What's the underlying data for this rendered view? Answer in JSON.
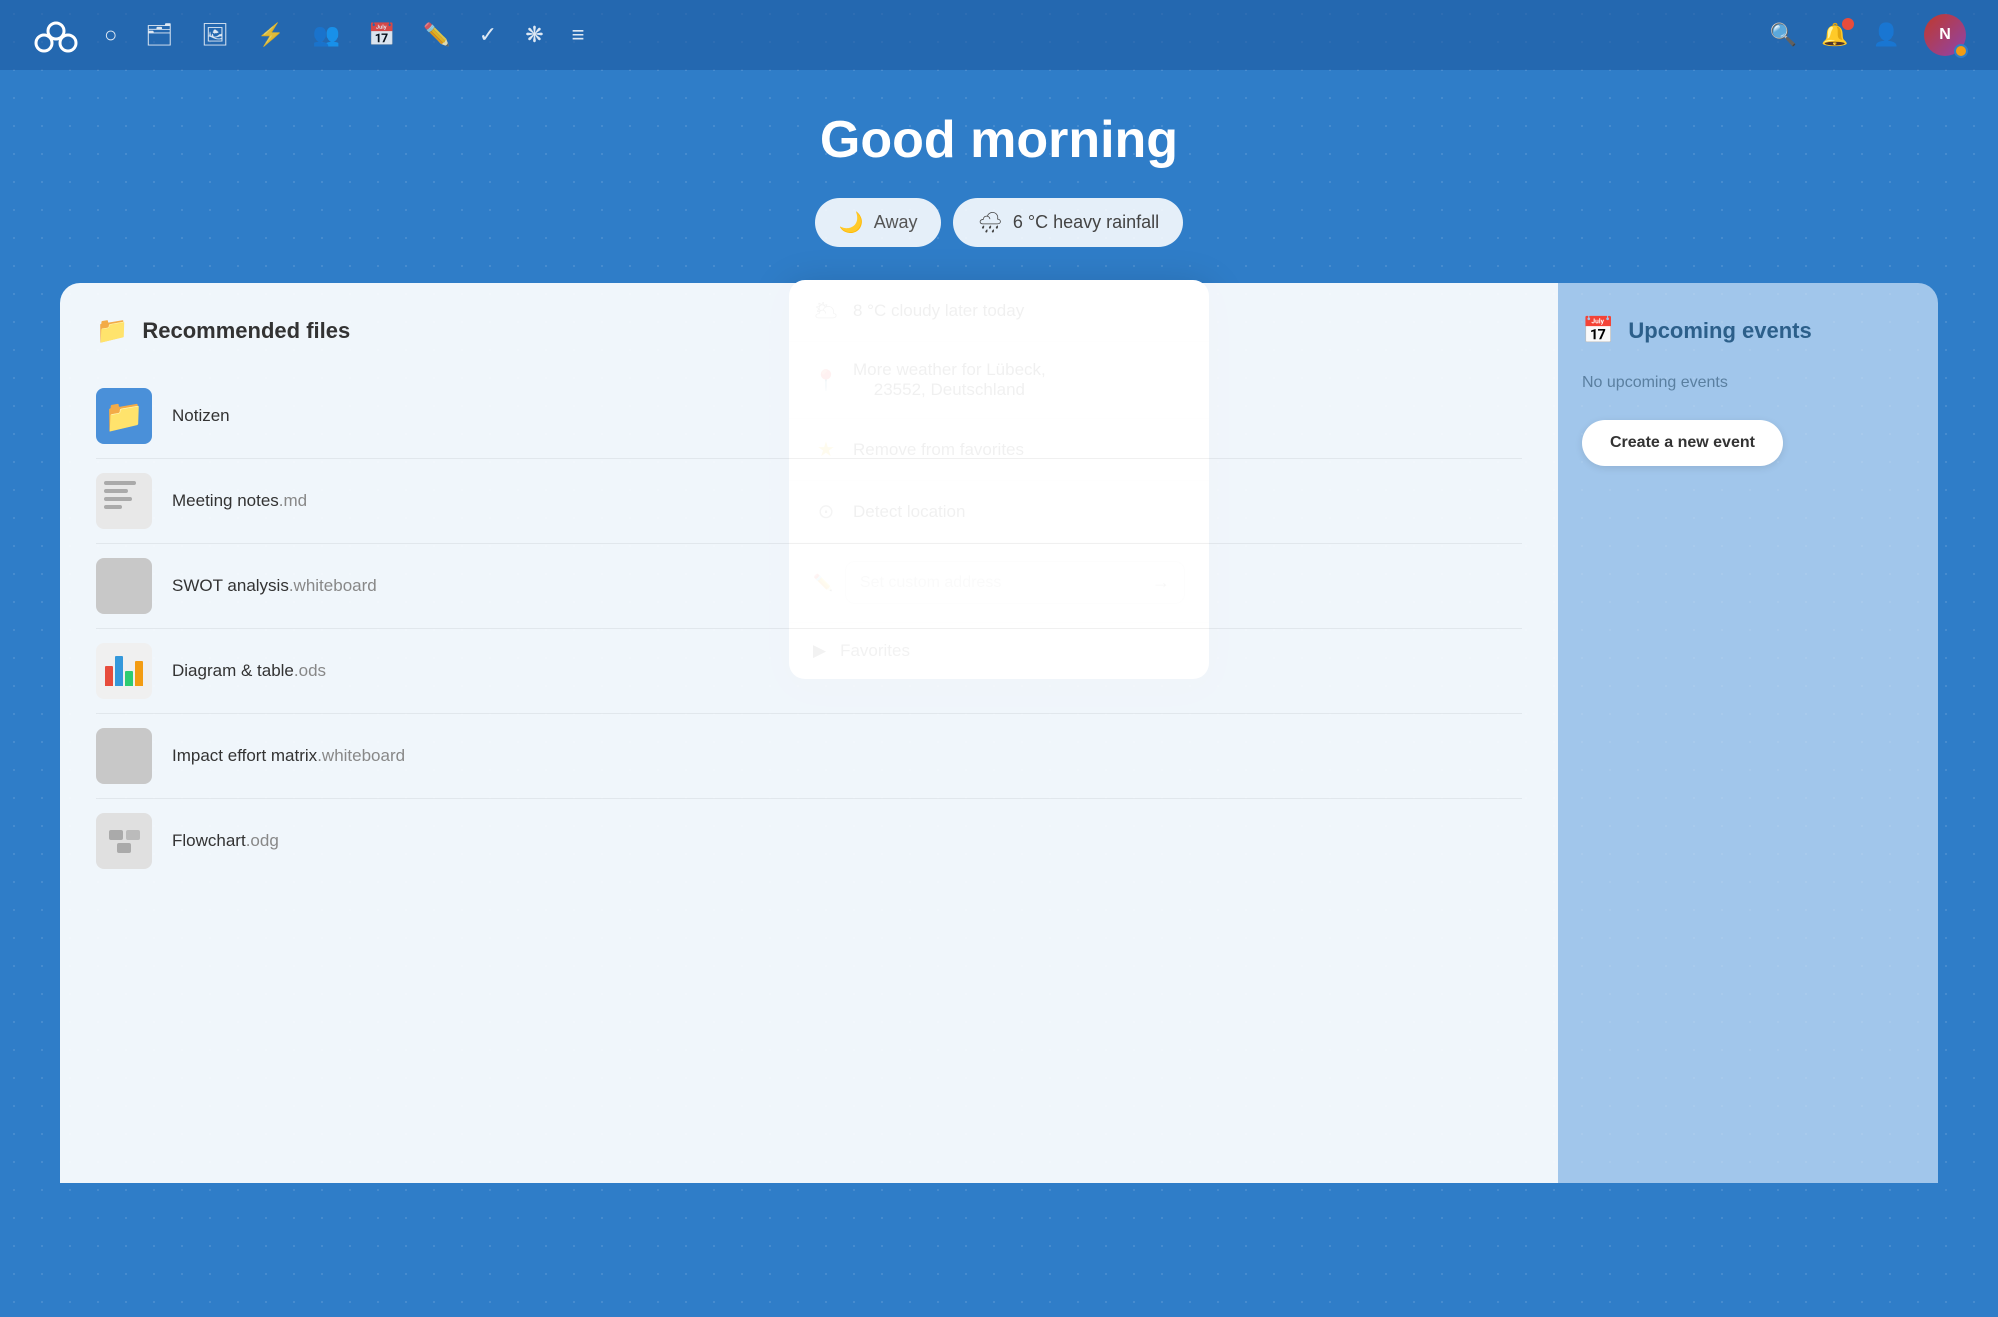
{
  "app": {
    "name": "Nextcloud"
  },
  "topnav": {
    "icons": [
      {
        "name": "dashboard-icon",
        "symbol": "○"
      },
      {
        "name": "files-icon",
        "symbol": "📁"
      },
      {
        "name": "photos-icon",
        "symbol": "🖼"
      },
      {
        "name": "activity-icon",
        "symbol": "⚡"
      },
      {
        "name": "contacts-icon",
        "symbol": "👥"
      },
      {
        "name": "calendar-icon",
        "symbol": "📅"
      },
      {
        "name": "notes-icon",
        "symbol": "✏"
      },
      {
        "name": "tasks-icon",
        "symbol": "✓"
      },
      {
        "name": "other-icon",
        "symbol": "❋"
      },
      {
        "name": "menu-icon",
        "symbol": "≡"
      }
    ],
    "search_label": "Search",
    "notifications_label": "Notifications",
    "user_label": "User",
    "avatar_initials": "N"
  },
  "greeting": {
    "title": "Good morning"
  },
  "pills": {
    "away_label": "Away",
    "weather_label": "6 °C heavy rainfall",
    "weather_icon": "🌧"
  },
  "weather_dropdown": {
    "forecast_icon": "🌥",
    "forecast_text": "8 °C cloudy later today",
    "location_label": "More weather for Lübeck,",
    "location_sublabel": "23552, Deutschland",
    "remove_favorites_label": "Remove from favorites",
    "detect_location_label": "Detect location",
    "set_custom_address_placeholder": "Set custom address",
    "favorites_label": "Favorites"
  },
  "files_panel": {
    "header_title": "Recommended files",
    "files": [
      {
        "name": "Notizen",
        "type": "folder",
        "icon": "folder"
      },
      {
        "name": "Meeting notes",
        "ext": ".md",
        "type": "md"
      },
      {
        "name": "SWOT analysis",
        "ext": ".whiteboard",
        "type": "whiteboard"
      },
      {
        "name": "Diagram & table",
        "ext": ".ods",
        "type": "ods"
      },
      {
        "name": "Impact effort matrix",
        "ext": ".whiteboard",
        "type": "whiteboard"
      },
      {
        "name": "Flowchart",
        "ext": ".odg",
        "type": "odg"
      }
    ]
  },
  "events_panel": {
    "header_title": "Upcoming events",
    "no_events_text": "No upcoming events",
    "create_event_label": "Create a new event"
  }
}
